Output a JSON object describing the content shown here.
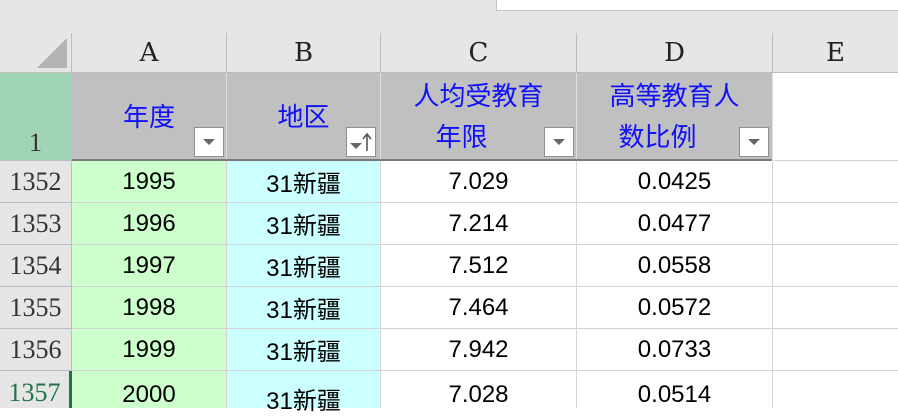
{
  "columns": [
    "A",
    "B",
    "C",
    "D",
    "E"
  ],
  "header": {
    "row_number": "1",
    "a": "年度",
    "b": "地区",
    "c_line1": "人均受教育",
    "c_line2": "年限",
    "d_line1": "高等教育人",
    "d_line2": "数比例"
  },
  "rows": [
    {
      "n": "1352",
      "year": "1995",
      "region": "31新疆",
      "edu_years": "7.029",
      "ratio": "0.0425"
    },
    {
      "n": "1353",
      "year": "1996",
      "region": "31新疆",
      "edu_years": "7.214",
      "ratio": "0.0477"
    },
    {
      "n": "1354",
      "year": "1997",
      "region": "31新疆",
      "edu_years": "7.512",
      "ratio": "0.0558"
    },
    {
      "n": "1355",
      "year": "1998",
      "region": "31新疆",
      "edu_years": "7.464",
      "ratio": "0.0572"
    },
    {
      "n": "1356",
      "year": "1999",
      "region": "31新疆",
      "edu_years": "7.942",
      "ratio": "0.0733"
    },
    {
      "n": "1357",
      "year": "2000",
      "region": "31新疆",
      "edu_years": "7.028",
      "ratio": "0.0514"
    }
  ],
  "colors": {
    "col_a_fill": "#ccffcc",
    "col_b_fill": "#ccffff",
    "header_fill": "#c0c0c0",
    "header_text": "#1010ff",
    "active_row": "#217346"
  }
}
